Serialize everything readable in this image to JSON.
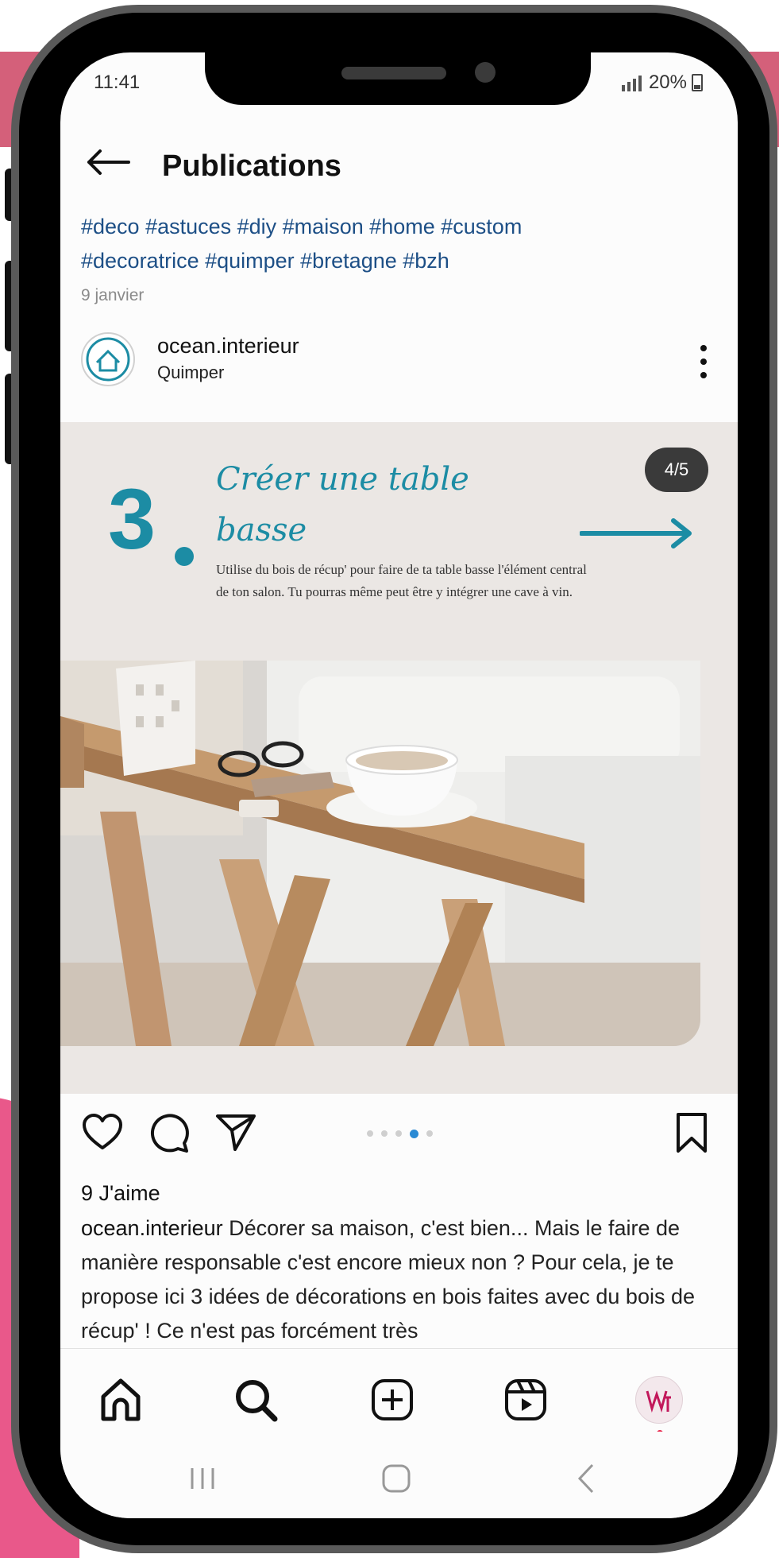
{
  "status_bar": {
    "time": "11:41",
    "battery": "20%"
  },
  "header": {
    "title": "Publications"
  },
  "post": {
    "hashtags_line1": "#deco #astuces #diy #maison #home #custom",
    "hashtags_line2": "#decoratrice #quimper #bretagne #bzh",
    "date": "9 janvier",
    "account_name": "ocean.interieur",
    "location": "Quimper",
    "carousel": {
      "counter": "4/5",
      "step_number": "3",
      "title_line1": "Créer une table",
      "title_line2": "basse",
      "body": "Utilise du bois de récup' pour faire de ta table basse l'élément central de ton salon. Tu pourras même peut être y intégrer une cave à vin.",
      "current_slide": 4,
      "total_slides": 5
    },
    "likes": "9 J'aime",
    "caption_user": "ocean.interieur",
    "caption_text": " Décorer sa maison, c'est bien... Mais le faire de manière responsable c'est encore mieux non ? Pour cela, je te propose ici 3 idées de décorations en bois faites avec du bois de récup' ! Ce n'est pas forcément très"
  },
  "icons": {
    "back": "arrow-left-icon",
    "more": "three-dots-vertical-icon",
    "like": "heart-icon",
    "comment": "comment-bubble-icon",
    "share": "paper-plane-icon",
    "save": "bookmark-icon",
    "home": "home-icon",
    "search": "search-icon",
    "create": "plus-square-icon",
    "reels": "reels-icon",
    "profile": "profile-avatar-icon"
  },
  "colors": {
    "accent_teal": "#1c8ca4",
    "hashtag_blue": "#1d4f86",
    "active_dot": "#2a8ad4",
    "background_pink": "#d4607a"
  }
}
